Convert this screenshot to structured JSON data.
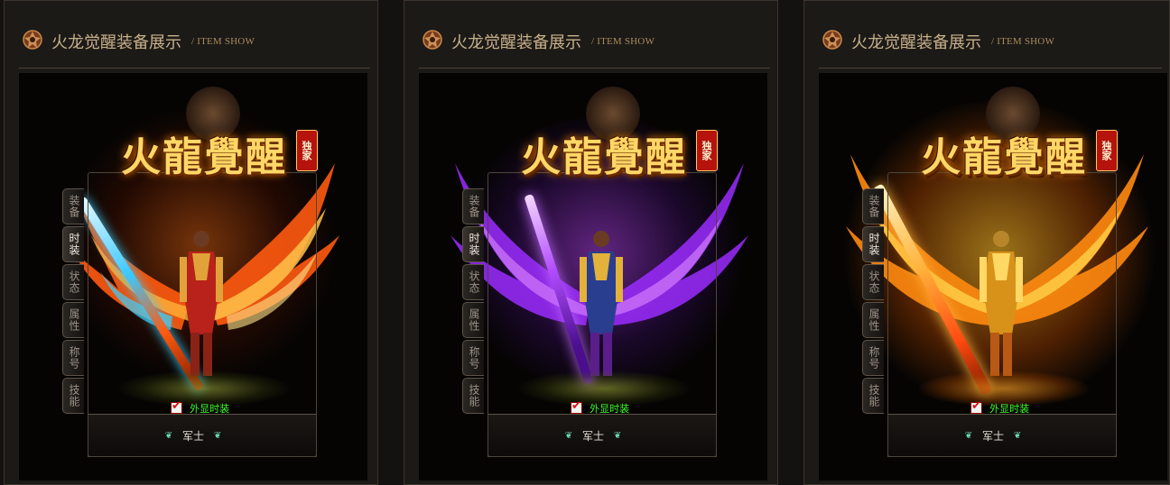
{
  "panels": [
    {
      "title": "火龙觉醒装备展示",
      "subtitle": "/ ITEM SHOW",
      "theme": "fire-ice",
      "accent": "#ff7a1a",
      "logo_text": "火龍覺醒",
      "logo_badge": "独家",
      "tabs": [
        "装备",
        "时装",
        "状态",
        "属性",
        "称号",
        "技能"
      ],
      "active_tab": "时装",
      "checkbox_label": "外显时装",
      "checkbox_checked": true,
      "class_label": "军士"
    },
    {
      "title": "火龙觉醒装备展示",
      "subtitle": "/ ITEM SHOW",
      "theme": "violet",
      "accent": "#b24cff",
      "logo_text": "火龍覺醒",
      "logo_badge": "独家",
      "tabs": [
        "装备",
        "时装",
        "状态",
        "属性",
        "称号",
        "技能"
      ],
      "active_tab": "时装",
      "checkbox_label": "外显时装",
      "checkbox_checked": true,
      "class_label": "军士"
    },
    {
      "title": "火龙觉醒装备展示",
      "subtitle": "/ ITEM SHOW",
      "theme": "gold-fire",
      "accent": "#ffb21a",
      "logo_text": "火龍覺醒",
      "logo_badge": "独家",
      "tabs": [
        "装备",
        "时装",
        "状态",
        "属性",
        "称号",
        "技能"
      ],
      "active_tab": "时装",
      "checkbox_label": "外显时装",
      "checkbox_checked": true,
      "class_label": "军士"
    }
  ]
}
